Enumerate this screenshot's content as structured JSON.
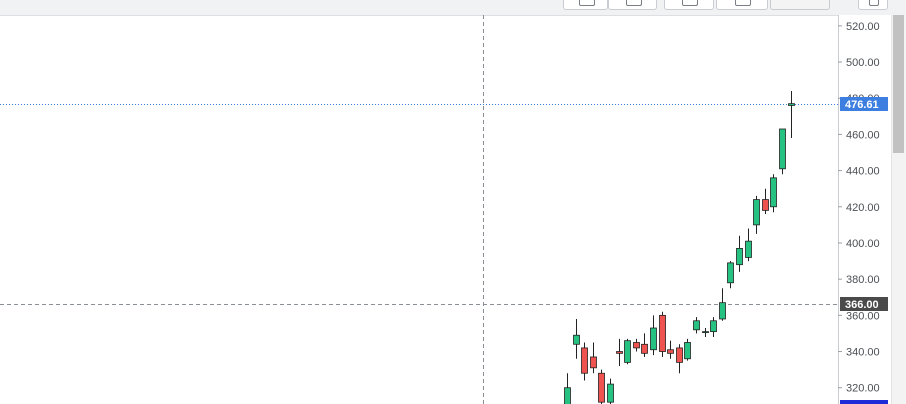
{
  "chart_data": {
    "type": "candlestick",
    "y_ticks": [
      320,
      340,
      360,
      380,
      400,
      420,
      440,
      460,
      480,
      500,
      520
    ],
    "ylim": [
      311,
      526
    ],
    "current_price": {
      "value": 476.61,
      "label": "476.61"
    },
    "crosshair": {
      "value": 366.0,
      "label": "366.00"
    },
    "candles": [
      {
        "o": 309,
        "h": 328,
        "l": 305,
        "c": 320
      },
      {
        "o": 344,
        "h": 358,
        "l": 336,
        "c": 349
      },
      {
        "o": 342,
        "h": 345,
        "l": 324,
        "c": 328
      },
      {
        "o": 337,
        "h": 345,
        "l": 328,
        "c": 331
      },
      {
        "o": 328,
        "h": 330,
        "l": 308,
        "c": 312
      },
      {
        "o": 312,
        "h": 325,
        "l": 305,
        "c": 322
      },
      {
        "o": 340,
        "h": 347,
        "l": 332,
        "c": 339
      },
      {
        "o": 334,
        "h": 347,
        "l": 333,
        "c": 346
      },
      {
        "o": 345,
        "h": 347,
        "l": 340,
        "c": 342
      },
      {
        "o": 344,
        "h": 350,
        "l": 337,
        "c": 339
      },
      {
        "o": 341,
        "h": 360,
        "l": 338,
        "c": 353
      },
      {
        "o": 360,
        "h": 362,
        "l": 337,
        "c": 340
      },
      {
        "o": 341,
        "h": 346,
        "l": 336,
        "c": 339
      },
      {
        "o": 342,
        "h": 344,
        "l": 328,
        "c": 334
      },
      {
        "o": 336,
        "h": 347,
        "l": 335,
        "c": 345
      },
      {
        "o": 352,
        "h": 359,
        "l": 350,
        "c": 357
      },
      {
        "o": 351,
        "h": 353,
        "l": 348,
        "c": 351
      },
      {
        "o": 351,
        "h": 359,
        "l": 348,
        "c": 357
      },
      {
        "o": 358,
        "h": 375,
        "l": 357,
        "c": 367
      },
      {
        "o": 378,
        "h": 390,
        "l": 375,
        "c": 389
      },
      {
        "o": 388,
        "h": 404,
        "l": 384,
        "c": 397
      },
      {
        "o": 392,
        "h": 408,
        "l": 390,
        "c": 401
      },
      {
        "o": 410,
        "h": 426,
        "l": 405,
        "c": 424
      },
      {
        "o": 424,
        "h": 430,
        "l": 416,
        "c": 418
      },
      {
        "o": 420,
        "h": 438,
        "l": 417,
        "c": 436
      },
      {
        "o": 441,
        "h": 463,
        "l": 438,
        "c": 463
      },
      {
        "o": 476,
        "h": 484,
        "l": 458,
        "c": 477
      }
    ],
    "colors": {
      "up": "#26c281",
      "down": "#ef5350",
      "current_label_bg": "#3d7fe0",
      "crosshair_label_bg": "#4a4a4a",
      "bottom_label_bg": "#1e2bd8"
    },
    "grid": false
  }
}
